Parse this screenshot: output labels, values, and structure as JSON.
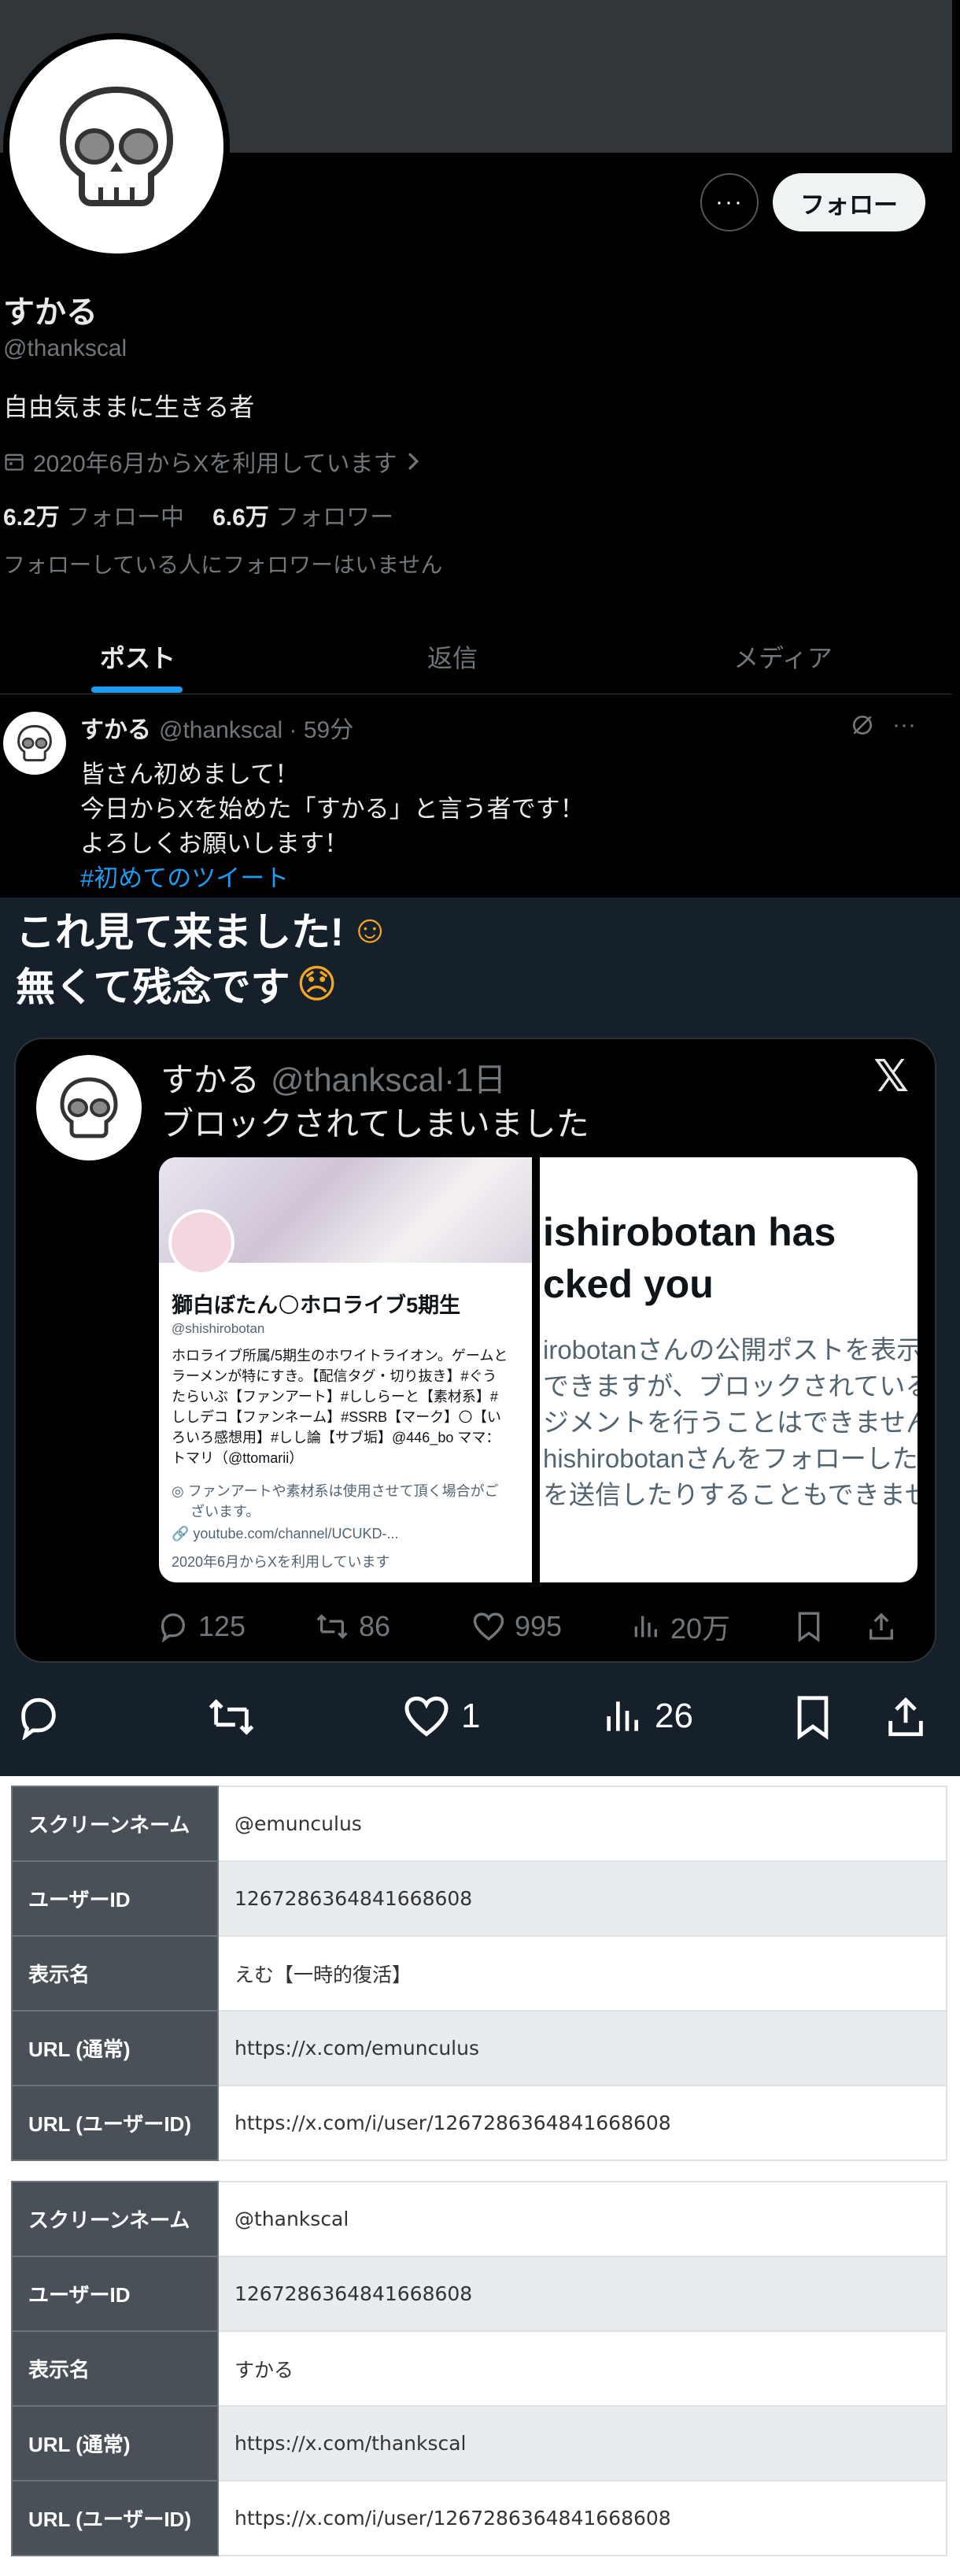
{
  "profile": {
    "display_name": "すかる",
    "handle": "@thankscal",
    "bio": "自由気ままに生きる者",
    "joined": "2020年6月からXを利用しています",
    "following_count": "6.2万",
    "following_label": "フォロー中",
    "followers_count": "6.6万",
    "followers_label": "フォロワー",
    "followers_note": "フォローしている人にフォロワーはいません",
    "more_label": "···",
    "follow_label": "フォロー"
  },
  "tabs": [
    "ポスト",
    "返信",
    "メディア"
  ],
  "tweet": {
    "name": "すかる",
    "handle": "@thankscal · 59分",
    "lines": [
      "皆さん初めまして！",
      "今日からXを始めた「すかる」と言う者です！",
      "よろしくお願いします！"
    ],
    "hashtag": "#初めてのツイート"
  },
  "reply": {
    "line1": "これ見て来ました!",
    "line2": "無くて残念です",
    "emoji1": "☺",
    "emoji2": "😞",
    "quote": {
      "name": "すかる",
      "handle": "@thankscal·1日",
      "text": "ブロックされてしまいました",
      "x_logo": "𝕏",
      "screenshot_left": {
        "name": "獅白ぼたん🌕ホロライブ5期生",
        "handle": "@shishirobotan",
        "bio_lines": [
          "ホロライブ所属/5期生のホワイトライオン。ゲームと",
          "ラーメンが特にすき。【配信タグ・切り抜き】#ぐう",
          "たらいぶ【ファンアート】#ししらーと【素材系】#",
          "ししデコ【ファンネーム】#SSRB【マーク】🌕【い",
          "ろいろ感想用】#しし論【サブ垢】@446_bo ママ：",
          "トマリ（@ttomarii）"
        ],
        "meta1": "ファンアートや素材系は使用させて頂く場合がご",
        "meta1b": "ざいます。",
        "meta2": "youtube.com/channel/UCUKD-...",
        "meta3": "2020年6月からXを利用しています"
      },
      "screenshot_right": {
        "title": "ishirobotan has\ncked you",
        "body": [
          "irobotanさんの公開ポストを表示",
          "できますが、ブロックされているた",
          "ジメントを行うことはできません。",
          "hishirobotanさんをフォローした",
          "を送信したりすることもできません"
        ]
      },
      "actions": {
        "replies": "125",
        "reposts": "86",
        "likes": "995",
        "views": "20万"
      }
    },
    "actions": {
      "likes": "1",
      "views": "26"
    }
  },
  "tables": [
    {
      "rows": [
        {
          "key": "スクリーンネーム",
          "value": "@emunculus"
        },
        {
          "key": "ユーザーID",
          "value": "1267286364841668608"
        },
        {
          "key": "表示名",
          "value": "えむ【一時的復活】"
        },
        {
          "key": "URL (通常)",
          "value": "https://x.com/emunculus"
        },
        {
          "key": "URL (ユーザーID)",
          "value": "https://x.com/i/user/1267286364841668608"
        }
      ]
    },
    {
      "rows": [
        {
          "key": "スクリーンネーム",
          "value": "@thankscal"
        },
        {
          "key": "ユーザーID",
          "value": "1267286364841668608"
        },
        {
          "key": "表示名",
          "value": "すかる"
        },
        {
          "key": "URL (通常)",
          "value": "https://x.com/thankscal"
        },
        {
          "key": "URL (ユーザーID)",
          "value": "https://x.com/i/user/1267286364841668608"
        }
      ]
    }
  ],
  "colors": {
    "accent": "#1d9bf0",
    "bg_dark": "#000000",
    "bg_dim": "#15202b",
    "table_key": "#495057"
  }
}
